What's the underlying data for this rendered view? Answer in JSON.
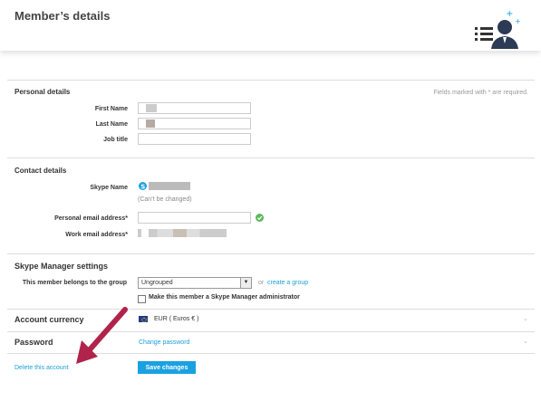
{
  "header": {
    "title": "Member’s details",
    "icon": "member-list-icon"
  },
  "personal": {
    "title": "Personal details",
    "required_note": "Fields marked with * are required.",
    "first_name_label": "First Name",
    "last_name_label": "Last Name",
    "job_title_label": "Job title"
  },
  "contact": {
    "title": "Contact details",
    "skype_name_label": "Skype Name",
    "cant_change_note": "(Can’t be changed)",
    "personal_email_label": "Personal email address*",
    "work_email_label": "Work email address*"
  },
  "skype_manager": {
    "title": "Skype Manager settings",
    "group_label": "This member belongs to the group",
    "group_value": "Ungrouped",
    "or_text": "or",
    "create_group_link": "create a group",
    "admin_checkbox_label": "Make this member a Skype Manager administrator"
  },
  "currency": {
    "title": "Account currency",
    "value": "EUR ( Euros € )"
  },
  "password": {
    "title": "Password",
    "link": "Change password"
  },
  "footer": {
    "delete_link": "Delete this account",
    "save_button": "Save changes"
  },
  "colors": {
    "accent": "#1aa1e1",
    "annotation_arrow": "#b0234a",
    "check_green": "#5cb85c"
  }
}
